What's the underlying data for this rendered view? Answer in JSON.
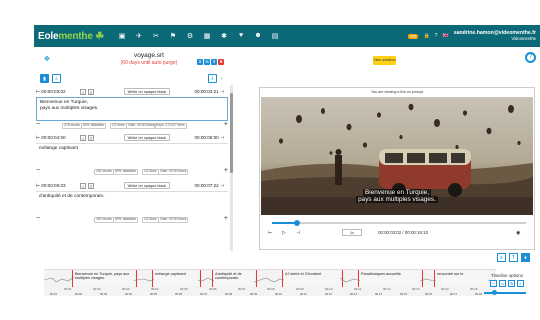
{
  "topbar": {
    "logo_main": "Eole",
    "logo_accent": "menthe",
    "icons": [
      "video-camera-icon",
      "plane-icon",
      "scissors-icon",
      "flag-icon",
      "gear-icon",
      "table-icon",
      "settings-icon",
      "heart-icon",
      "users-icon",
      "image-icon"
    ],
    "lang_badge": "FR",
    "user_email": "sandrine.hamon@videomenthe.fr",
    "user_role": "Videomenthe",
    "flag": "🇬🇧"
  },
  "header": {
    "project_title": "voyage.srt",
    "project_subtitle": "(60 days until auto purge)",
    "yellow_button": "View workflow",
    "help": "?"
  },
  "left_panel": {
    "toolbar_plus": "+",
    "blocks": [
      {
        "start": "00:00:03:02",
        "end": "00:00:03:21",
        "style": "White on opaque black",
        "text_line1": "Bienvenue en Turquie,",
        "text_line2": "pays aux multiples visages.",
        "meta": [
          "278 words",
          "50% dilatation",
          "2/2 lines",
          "Gain: 00:00 black",
          "Keys: 27/1/27 lines"
        ]
      },
      {
        "start": "00:00:04:00",
        "end": "00:00:06:00",
        "style": "White on opaque black",
        "text_line1": "mélange captivant",
        "text_line2": "",
        "meta": [
          "250 words",
          "50% dilatation",
          "1/2 lines",
          "Gain: 00:00 black"
        ]
      },
      {
        "start": "00:00:06:03",
        "end": "00:00:07:22",
        "style": "White on opaque black",
        "text_line1": "d'antiquité et de contemporain.",
        "text_line2": "",
        "meta": [
          "350 words",
          "50% dilatation",
          "1/2 lines",
          "Gain: 00:00 black"
        ]
      }
    ]
  },
  "video": {
    "top_caption": "You are viewing a live on prompt",
    "subtitle_line1": "Bienvenue en Turquie,",
    "subtitle_line2": "pays aux multiples visages.",
    "progress": 0.1,
    "speed": "1x",
    "timecode": "00:00:03:02 / 00:00:19:10"
  },
  "timeline": {
    "blocks": [
      {
        "text": "Bienvenue en Turquie, pays aux multiples visages."
      },
      {
        "text": "mélange captivant"
      },
      {
        "text": "d'antiquité et de contemporain."
      },
      {
        "text": "A l'orient et l'Occident"
      },
      {
        "text": "Paradisiaques accueille"
      },
      {
        "text": "rencontré sur le"
      }
    ],
    "ticks": [
      "00:01",
      "00:02",
      "00:03",
      "00:04",
      "00:05",
      "00:06",
      "00:07",
      "00:08",
      "00:09",
      "00:10",
      "00:11",
      "00:12",
      "00:13",
      "00:14",
      "00:15"
    ],
    "axis": [
      "00:01",
      "00:02",
      "00:03",
      "00:04",
      "00:05",
      "00:06",
      "00:07",
      "00:08",
      "00:09",
      "00:10",
      "00:11",
      "00:12",
      "00:13",
      "00:14",
      "00:15",
      "00:16",
      "00:17",
      "00:18"
    ],
    "options_title": "Timeline options"
  }
}
